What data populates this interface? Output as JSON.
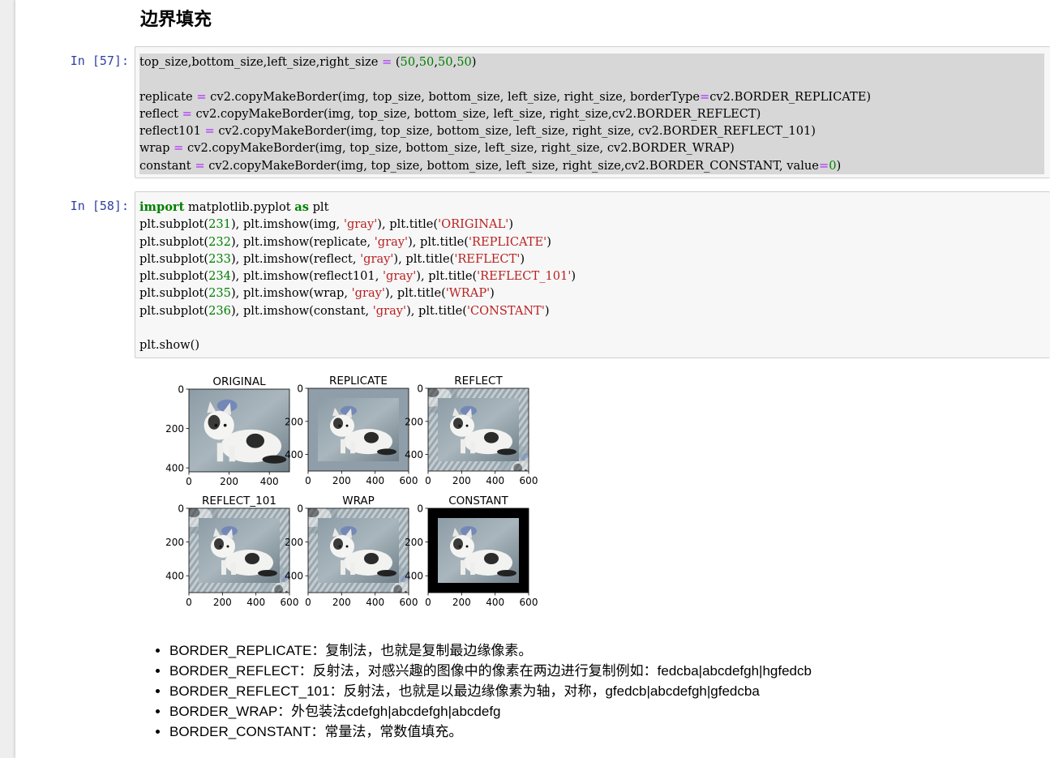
{
  "section_heading": "边界填充",
  "cells": [
    {
      "prompt": "In  [57]:",
      "lines": [
        [
          [
            "top_size,bottom_size,left_size,right_size ",
            ""
          ],
          [
            "=",
            "op"
          ],
          [
            " (",
            ""
          ],
          [
            "50",
            "num"
          ],
          [
            ",",
            ""
          ],
          [
            "50",
            "num"
          ],
          [
            ",",
            ""
          ],
          [
            "50",
            "num"
          ],
          [
            ",",
            ""
          ],
          [
            "50",
            "num"
          ],
          [
            ")",
            ""
          ]
        ],
        [],
        [
          [
            "replicate ",
            ""
          ],
          [
            "=",
            "op"
          ],
          [
            " cv2.copyMakeBorder(img, top_size, bottom_size, left_size, right_size, borderType",
            ""
          ],
          [
            "=",
            "op"
          ],
          [
            "cv2.BORDER_REPLICATE)",
            ""
          ]
        ],
        [
          [
            "reflect ",
            ""
          ],
          [
            "=",
            "op"
          ],
          [
            " cv2.copyMakeBorder(img, top_size, bottom_size, left_size, right_size,cv2.BORDER_REFLECT)",
            ""
          ]
        ],
        [
          [
            "reflect101 ",
            ""
          ],
          [
            "=",
            "op"
          ],
          [
            " cv2.copyMakeBorder(img, top_size, bottom_size, left_size, right_size, cv2.BORDER_REFLECT_101)",
            ""
          ]
        ],
        [
          [
            "wrap ",
            ""
          ],
          [
            "=",
            "op"
          ],
          [
            " cv2.copyMakeBorder(img, top_size, bottom_size, left_size, right_size, cv2.BORDER_WRAP)",
            ""
          ]
        ],
        [
          [
            "constant ",
            ""
          ],
          [
            "=",
            "op"
          ],
          [
            " cv2.copyMakeBorder(img, top_size, bottom_size, left_size, right_size,cv2.BORDER_CONSTANT, value",
            ""
          ],
          [
            "=",
            "op"
          ],
          [
            "0",
            "num"
          ],
          [
            ")",
            ""
          ]
        ]
      ]
    },
    {
      "prompt": "In  [58]:",
      "lines": [
        [
          [
            "import",
            "kw"
          ],
          [
            " matplotlib.pyplot ",
            ""
          ],
          [
            "as",
            "kw"
          ],
          [
            " plt",
            ""
          ]
        ],
        [
          [
            "plt.subplot(",
            ""
          ],
          [
            "231",
            "num"
          ],
          [
            "), plt.imshow(img, ",
            ""
          ],
          [
            "'gray'",
            "str"
          ],
          [
            "), plt.title(",
            ""
          ],
          [
            "'ORIGINAL'",
            "str"
          ],
          [
            ")",
            ""
          ]
        ],
        [
          [
            "plt.subplot(",
            ""
          ],
          [
            "232",
            "num"
          ],
          [
            "), plt.imshow(replicate, ",
            ""
          ],
          [
            "'gray'",
            "str"
          ],
          [
            "), plt.title(",
            ""
          ],
          [
            "'REPLICATE'",
            "str"
          ],
          [
            ")",
            ""
          ]
        ],
        [
          [
            "plt.subplot(",
            ""
          ],
          [
            "233",
            "num"
          ],
          [
            "), plt.imshow(reflect, ",
            ""
          ],
          [
            "'gray'",
            "str"
          ],
          [
            "), plt.title(",
            ""
          ],
          [
            "'REFLECT'",
            "str"
          ],
          [
            ")",
            ""
          ]
        ],
        [
          [
            "plt.subplot(",
            ""
          ],
          [
            "234",
            "num"
          ],
          [
            "), plt.imshow(reflect101, ",
            ""
          ],
          [
            "'gray'",
            "str"
          ],
          [
            "), plt.title(",
            ""
          ],
          [
            "'REFLECT_101'",
            "str"
          ],
          [
            ")",
            ""
          ]
        ],
        [
          [
            "plt.subplot(",
            ""
          ],
          [
            "235",
            "num"
          ],
          [
            "), plt.imshow(wrap, ",
            ""
          ],
          [
            "'gray'",
            "str"
          ],
          [
            "), plt.title(",
            ""
          ],
          [
            "'WRAP'",
            "str"
          ],
          [
            ")",
            ""
          ]
        ],
        [
          [
            "plt.subplot(",
            ""
          ],
          [
            "236",
            "num"
          ],
          [
            "), plt.imshow(constant, ",
            ""
          ],
          [
            "'gray'",
            "str"
          ],
          [
            "), plt.title(",
            ""
          ],
          [
            "'CONSTANT'",
            "str"
          ],
          [
            ")",
            ""
          ]
        ],
        [],
        [
          [
            "plt.show()",
            ""
          ]
        ]
      ]
    }
  ],
  "figure": {
    "panels": [
      {
        "title": "ORIGINAL",
        "border": "none",
        "xticks": [
          "0",
          "200",
          "400"
        ],
        "yticks": [
          "0",
          "200",
          "400"
        ]
      },
      {
        "title": "REPLICATE",
        "border": "replicate",
        "xticks": [
          "0",
          "200",
          "400",
          "600"
        ],
        "yticks": [
          "0",
          "200",
          "400"
        ]
      },
      {
        "title": "REFLECT",
        "border": "reflect",
        "xticks": [
          "0",
          "200",
          "400",
          "600"
        ],
        "yticks": [
          "0",
          "200",
          "400"
        ]
      },
      {
        "title": "REFLECT_101",
        "border": "reflect",
        "xticks": [
          "0",
          "200",
          "400",
          "600"
        ],
        "yticks": [
          "0",
          "200",
          "400"
        ]
      },
      {
        "title": "WRAP",
        "border": "wrap",
        "xticks": [
          "0",
          "200",
          "400",
          "600"
        ],
        "yticks": [
          "0",
          "200",
          "400"
        ]
      },
      {
        "title": "CONSTANT",
        "border": "constant",
        "xticks": [
          "0",
          "200",
          "400",
          "600"
        ],
        "yticks": [
          "0",
          "200",
          "400"
        ]
      }
    ]
  },
  "bullets": [
    "BORDER_REPLICATE：复制法，也就是复制最边缘像素。",
    "BORDER_REFLECT：反射法，对感兴趣的图像中的像素在两边进行复制例如：fedcba|abcdefgh|hgfedcb",
    "BORDER_REFLECT_101：反射法，也就是以最边缘像素为轴，对称，gfedcb|abcdefgh|gfedcba",
    "BORDER_WRAP：外包装法cdefgh|abcdefgh|abcdefg",
    "BORDER_CONSTANT：常量法，常数值填充。"
  ],
  "colors": {
    "prompt": "#303f9f",
    "keyword": "#008000",
    "number": "#008000",
    "string": "#ba2121",
    "operator": "#aa22ff",
    "selection": "#d7d7d7"
  }
}
